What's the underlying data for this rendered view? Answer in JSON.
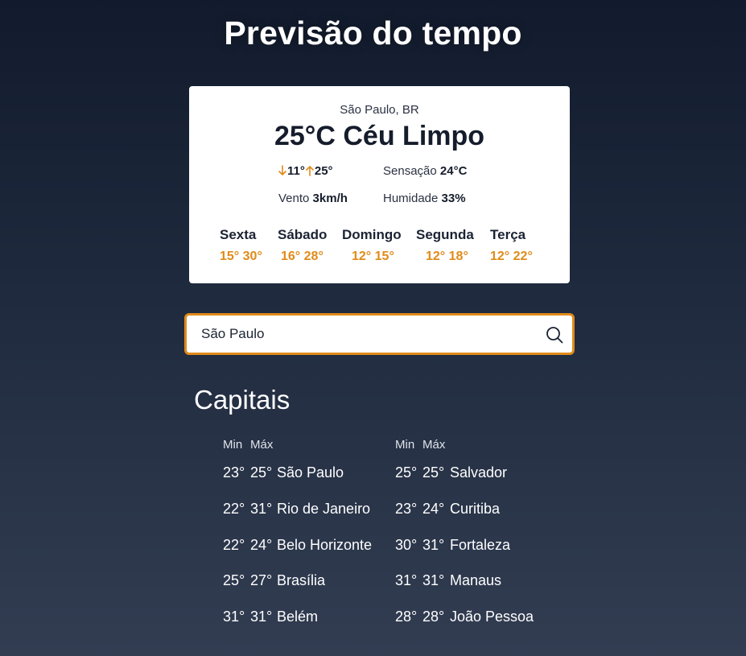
{
  "page": {
    "title": "Previsão do tempo"
  },
  "colors": {
    "accent": "#e08b1a",
    "card_bg": "#ffffff",
    "page_bg_top": "#121b2d",
    "page_bg_bottom": "#323d52"
  },
  "current": {
    "city": "São Paulo, BR",
    "summary": "25°C Céu Limpo",
    "min": "11°",
    "max": "25°",
    "feels_label": "Sensação",
    "feels_value": "24°C",
    "wind_label": "Vento",
    "wind_value": "3km/h",
    "humidity_label": "Humidade",
    "humidity_value": "33%"
  },
  "forecast": [
    {
      "day": "Sexta",
      "min": "15°",
      "max": "30°"
    },
    {
      "day": "Sábado",
      "min": "16°",
      "max": "28°"
    },
    {
      "day": "Domingo",
      "min": "12°",
      "max": "15°"
    },
    {
      "day": "Segunda",
      "min": "12°",
      "max": "18°"
    },
    {
      "day": "Terça",
      "min": "12°",
      "max": "22°"
    }
  ],
  "search": {
    "value": "São Paulo",
    "icon": "search-icon"
  },
  "capitals": {
    "title": "Capitais",
    "min_label": "Min",
    "max_label": "Máx",
    "left": [
      {
        "min": "23°",
        "max": "25°",
        "city": "São Paulo"
      },
      {
        "min": "22°",
        "max": "31°",
        "city": "Rio de Janeiro"
      },
      {
        "min": "22°",
        "max": "24°",
        "city": "Belo Horizonte"
      },
      {
        "min": "25°",
        "max": "27°",
        "city": "Brasília"
      },
      {
        "min": "31°",
        "max": "31°",
        "city": "Belém"
      }
    ],
    "right": [
      {
        "min": "25°",
        "max": "25°",
        "city": "Salvador"
      },
      {
        "min": "23°",
        "max": "24°",
        "city": "Curitiba"
      },
      {
        "min": "30°",
        "max": "31°",
        "city": "Fortaleza"
      },
      {
        "min": "31°",
        "max": "31°",
        "city": "Manaus"
      },
      {
        "min": "28°",
        "max": "28°",
        "city": "João Pessoa"
      }
    ]
  }
}
